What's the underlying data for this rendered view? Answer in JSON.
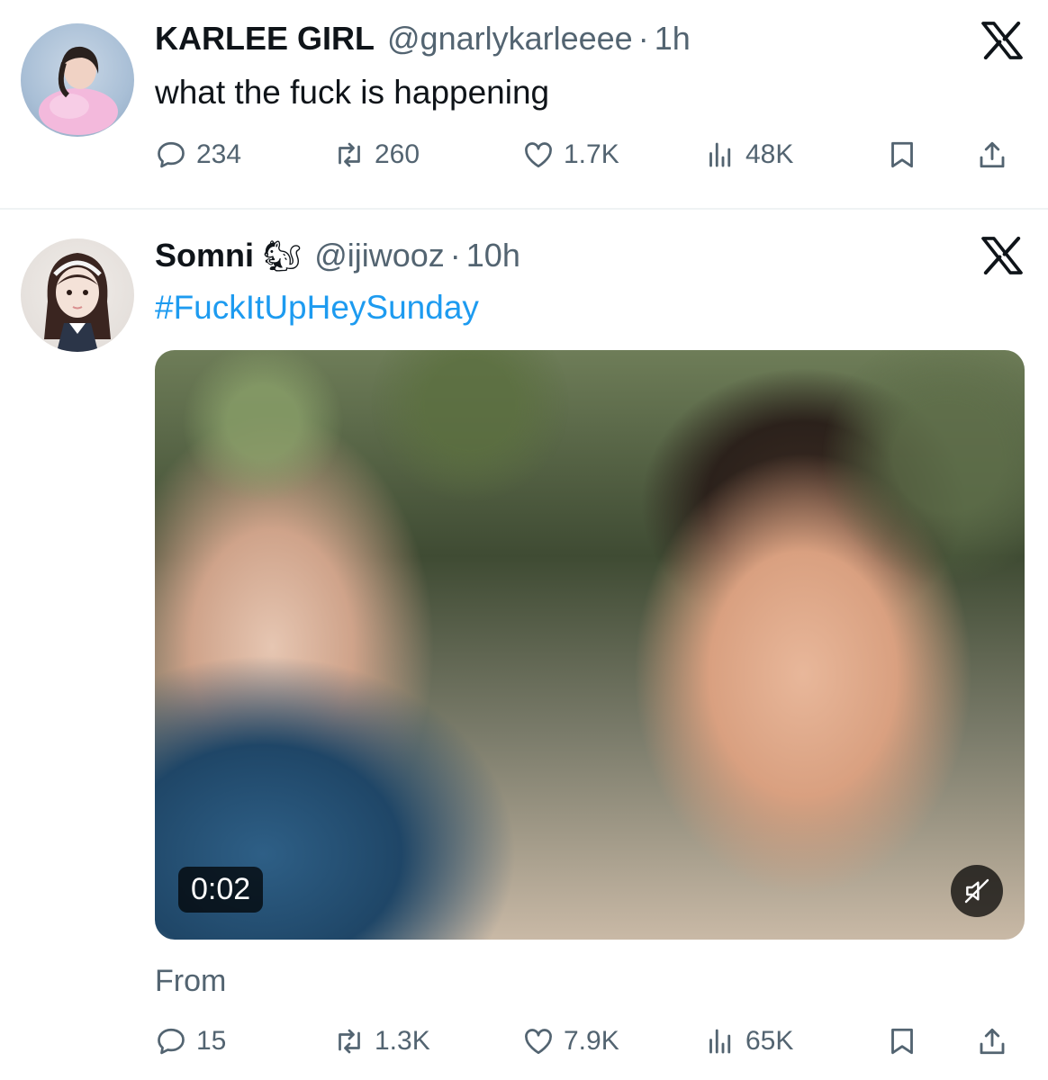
{
  "tweets": [
    {
      "display_name": "KARLEE GIRL",
      "handle": "@gnarlykarleeee",
      "separator": "·",
      "time": "1h",
      "text": "what the fuck is happening",
      "replies": "234",
      "retweets": "260",
      "likes": "1.7K",
      "views": "48K"
    },
    {
      "display_name": "Somni",
      "name_emoji": "🐿",
      "handle": "@ijiwooz",
      "separator": "·",
      "time": "10h",
      "text": "#FuckItUpHeySunday",
      "video": {
        "timestamp": "0:02",
        "muted": true
      },
      "from_label": "From",
      "replies": "15",
      "retweets": "1.3K",
      "likes": "7.9K",
      "views": "65K"
    }
  ],
  "icons": [
    "x-logo-icon",
    "reply-icon",
    "retweet-icon",
    "like-icon",
    "views-icon",
    "bookmark-icon",
    "share-icon",
    "mute-icon"
  ],
  "colors": {
    "text": "#0f1419",
    "secondary": "#536471",
    "hashtag": "#1d9bf0",
    "divider": "#eff3f4"
  }
}
